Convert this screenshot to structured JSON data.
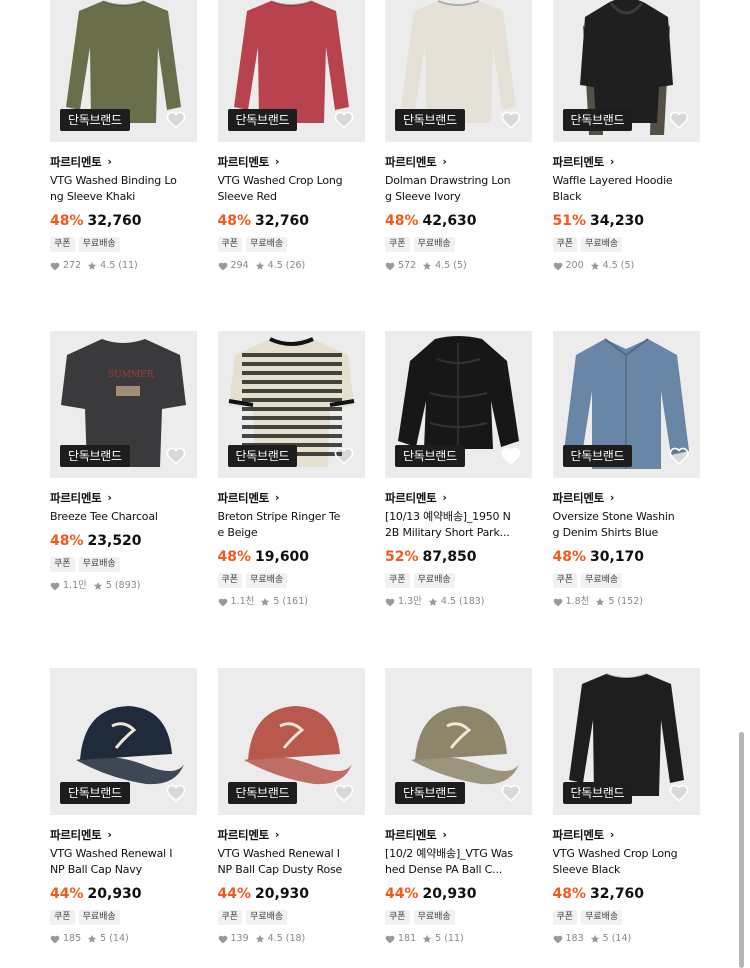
{
  "badge_label": "단독브랜드",
  "tags": [
    "쿠폰",
    "무료배송"
  ],
  "colors": {
    "discount": "#f35a1a",
    "badge_bg": "#1d1d1d",
    "thumb_bg": "#ececec"
  },
  "products": [
    {
      "brand": "파르티멘토",
      "name": "VTG Washed Binding Long Sleeve Khaki",
      "discount": "48%",
      "price": "32,760",
      "likes": "272",
      "rating": "4.5",
      "reviews": "(11)",
      "liked": false,
      "illustration": "longsleeve",
      "color": "#6b6e4b"
    },
    {
      "brand": "파르티멘토",
      "name": "VTG Washed Crop Long Sleeve Red",
      "discount": "48%",
      "price": "32,760",
      "likes": "294",
      "rating": "4.5",
      "reviews": "(26)",
      "liked": false,
      "illustration": "longsleeve",
      "color": "#b8434e"
    },
    {
      "brand": "파르티멘토",
      "name": "Dolman Drawstring Long Sleeve Ivory",
      "discount": "48%",
      "price": "42,630",
      "likes": "572",
      "rating": "4.5",
      "reviews": "(5)",
      "liked": false,
      "illustration": "longsleeve",
      "color": "#e6e1d6"
    },
    {
      "brand": "파르티멘토",
      "name": "Waffle Layered Hoodie Black",
      "discount": "51%",
      "price": "34,230",
      "likes": "200",
      "rating": "4.5",
      "reviews": "(5)",
      "liked": false,
      "illustration": "hoodie",
      "color": "#1f1f1f"
    },
    {
      "brand": "파르티멘토",
      "name": "Breeze Tee Charcoal",
      "discount": "48%",
      "price": "23,520",
      "likes": "1.1만",
      "rating": "5",
      "reviews": "(893)",
      "liked": false,
      "illustration": "tee",
      "color": "#3a3a3c"
    },
    {
      "brand": "파르티멘토",
      "name": "Breton Stripe Ringer Tee Beige",
      "discount": "48%",
      "price": "19,600",
      "likes": "1.1천",
      "rating": "5",
      "reviews": "(161)",
      "liked": false,
      "illustration": "stripetee",
      "color": "#e4dfcf"
    },
    {
      "brand": "파르티멘토",
      "name": "[10/13 예약배송]_1950 N2B Military Short Park...",
      "discount": "52%",
      "price": "87,850",
      "likes": "1.3만",
      "rating": "4.5",
      "reviews": "(183)",
      "liked": true,
      "illustration": "parka",
      "color": "#171717"
    },
    {
      "brand": "파르티멘토",
      "name": "Oversize Stone Washing Denim Shirts Blue",
      "discount": "48%",
      "price": "30,170",
      "likes": "1.8천",
      "rating": "5",
      "reviews": "(152)",
      "liked": false,
      "illustration": "shirt",
      "color": "#6a86a6"
    },
    {
      "brand": "파르티멘토",
      "name": "VTG Washed Renewal INP Ball Cap Navy",
      "discount": "44%",
      "price": "20,930",
      "likes": "185",
      "rating": "5",
      "reviews": "(14)",
      "liked": false,
      "illustration": "cap",
      "color": "#1f2b3a"
    },
    {
      "brand": "파르티멘토",
      "name": "VTG Washed Renewal INP Ball Cap Dusty Rose",
      "discount": "44%",
      "price": "20,930",
      "likes": "139",
      "rating": "4.5",
      "reviews": "(18)",
      "liked": false,
      "illustration": "cap",
      "color": "#b9584d"
    },
    {
      "brand": "파르티멘토",
      "name": "[10/2 예약배송]_VTG Washed Dense PA Ball C...",
      "discount": "44%",
      "price": "20,930",
      "likes": "181",
      "rating": "5",
      "reviews": "(11)",
      "liked": false,
      "illustration": "cap",
      "color": "#8d866a"
    },
    {
      "brand": "파르티멘토",
      "name": "VTG Washed Crop Long Sleeve Black",
      "discount": "48%",
      "price": "32,760",
      "likes": "183",
      "rating": "5",
      "reviews": "(14)",
      "liked": false,
      "illustration": "longsleeve",
      "color": "#1e1e1e"
    }
  ]
}
